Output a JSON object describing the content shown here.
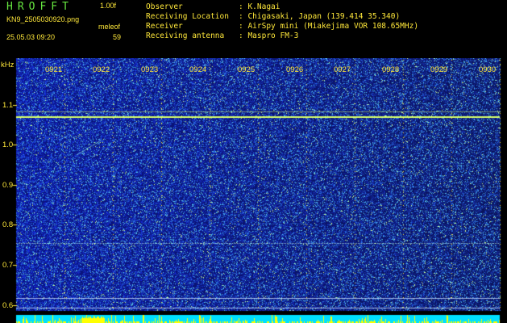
{
  "header": {
    "app_title": "HROFFT",
    "version": "1.00f",
    "filename": "KN9_2505030920.png",
    "timestamp": "25.05.03 09:20",
    "counter_label": "meleof",
    "counter_value": "59",
    "info": {
      "observer_label": "Observer",
      "observer_value": ": K.Nagai",
      "location_label": "Receiving Location",
      "location_value": ": Chigasaki, Japan (139.414 35.340)",
      "receiver_label": "Receiver",
      "receiver_value": ": AirSpy mini (Miakejima VOR 108.65MHz)",
      "antenna_label": "Receiving antenna",
      "antenna_value": ": Maspro FM-3"
    }
  },
  "plot": {
    "y_unit": "kHz",
    "y_ticks": [
      "1.1",
      "1.0",
      "0.9",
      "0.8",
      "0.7",
      "0.6"
    ],
    "x_ticks": [
      "0921",
      "0922",
      "0923",
      "0924",
      "0925",
      "0926",
      "0927",
      "0928",
      "0929",
      "0930"
    ]
  },
  "colors": {
    "text": "#ffe83a",
    "title": "#66e640",
    "background_noise": "#0a1a9c",
    "signal": "#d8ff6a",
    "bottom_bar": "#00e0ff",
    "bottom_spikes": "#ffff00"
  }
}
